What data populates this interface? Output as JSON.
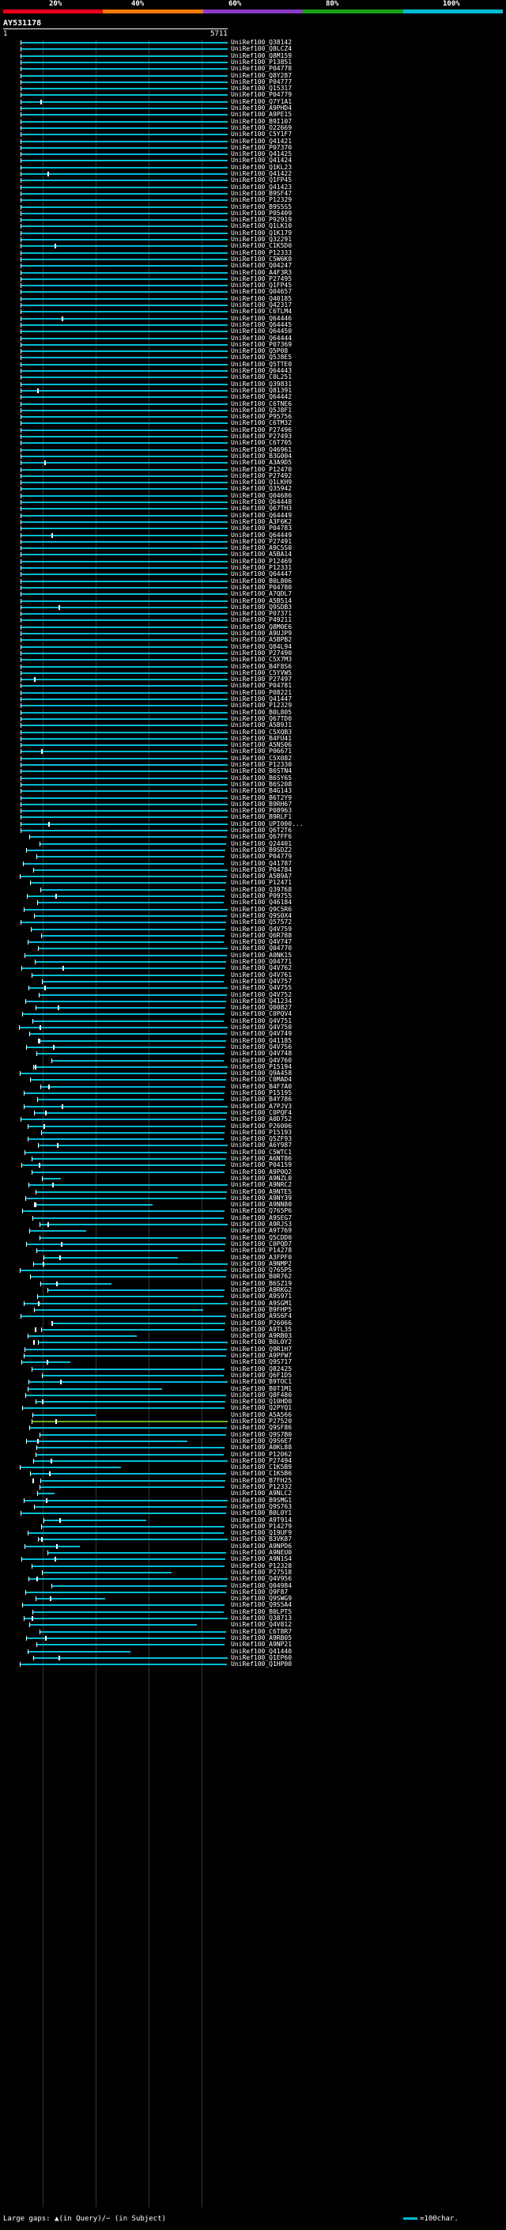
{
  "scale": {
    "labels": [
      "20%",
      "40%",
      "60%",
      "80%",
      "100%"
    ],
    "colors": [
      "#e8001c",
      "#f07800",
      "#8a3cc8",
      "#19a019",
      "#00bcd4"
    ]
  },
  "query": {
    "id": "AY531178",
    "start": "1",
    "end": "5711"
  },
  "hits": [
    "UniRef100_Q38142",
    "UniRef100_Q8LCZ4",
    "UniRef100_Q8M159",
    "UniRef100_P13851",
    "UniRef100_P04778",
    "UniRef100_Q8Y287",
    "UniRef100_P04777",
    "UniRef100_Q15317",
    "UniRef100_P04779",
    "UniRef100_Q7Y1A1",
    "UniRef100_A9PHD4",
    "UniRef100_A9PE15",
    "UniRef100_B9I107",
    "UniRef100_O22669",
    "UniRef100_C5Y1F7",
    "UniRef100_Q41421",
    "UniRef100_P07370",
    "UniRef100_Q41425",
    "UniRef100_Q41424",
    "UniRef100_Q1KL23",
    "UniRef100_Q41422",
    "UniRef100_Q1FP45",
    "UniRef100_Q41423",
    "UniRef100_B9SF47",
    "UniRef100_P12329",
    "UniRef100_B9S5S5",
    "UniRef100_P05409",
    "UniRef100_P92919",
    "UniRef100_Q1LK10",
    "UniRef100_Q1K179",
    "UniRef100_Q32291",
    "UniRef100_C1K5D0",
    "UniRef100_P12333",
    "UniRef100_C5W6K0",
    "UniRef100_Q04247",
    "UniRef100_A4F3R3",
    "UniRef100_P27495",
    "UniRef100_Q1FP45",
    "UniRef100_Q04657",
    "UniRef100_Q40185",
    "UniRef100_Q42317",
    "UniRef100_C6TLM4",
    "UniRef100_Q64446",
    "UniRef100_Q64445",
    "UniRef100_Q64450",
    "UniRef100_Q64444",
    "UniRef100_P07369",
    "UniRef100_Q5P08",
    "UniRef100_Q5J8E5",
    "UniRef100_Q5TTE0",
    "UniRef100_Q64443",
    "UniRef100_C0L251",
    "UniRef100_Q39831",
    "UniRef100_Q81391",
    "UniRef100_Q64442",
    "UniRef100_C6TNE6",
    "UniRef100_Q5J8F1",
    "UniRef100_P95756",
    "UniRef100_C6TM32",
    "UniRef100_P27496",
    "UniRef100_P27493",
    "UniRef100_C6T705",
    "UniRef100_Q46961",
    "UniRef100_B3G004",
    "UniRef100_A3A9D5",
    "UniRef100_P12470",
    "UniRef100_P27492",
    "UniRef100_Q1LKH9",
    "UniRef100_Q35942",
    "UniRef100_Q04686",
    "UniRef100_Q64448",
    "UniRef100_Q67TH3",
    "UniRef100_Q64449",
    "UniRef100_A3F6K2",
    "UniRef100_P04783",
    "UniRef100_Q64449",
    "UniRef100_P27491",
    "UniRef100_A9CSS0",
    "UniRef100_A5BA14",
    "UniRef100_P12469",
    "UniRef100_P12331",
    "UniRef100_Q64447",
    "UniRef100_B0L806",
    "UniRef100_P04780",
    "UniRef100_A7QDL7",
    "UniRef100_A5B514",
    "UniRef100_Q9SDB3",
    "UniRef100_P07371",
    "UniRef100_P49211",
    "UniRef100_Q8M0E6",
    "UniRef100_A9UJP9",
    "UniRef100_A5BPB2",
    "UniRef100_Q84L94",
    "UniRef100_P27490",
    "UniRef100_C5X7M3",
    "UniRef100_B4F8S6",
    "UniRef100_C5YVW5",
    "UniRef100_P27497",
    "UniRef100_P04781",
    "UniRef100_P08221",
    "UniRef100_Q41447",
    "UniRef100_P12329",
    "UniRef100_B0L805",
    "UniRef100_Q67TD0",
    "UniRef100_A5B9J1",
    "UniRef100_C5XQB3",
    "UniRef100_B4FU41",
    "UniRef100_A5NS06",
    "UniRef100_P06671",
    "UniRef100_C5X082",
    "UniRef100_P12330",
    "UniRef100_B6STN4",
    "UniRef100_B6SY65",
    "UniRef100_B6S208",
    "UniRef100_B4G143",
    "UniRef100_B6T2Y9",
    "UniRef100_B9RH67",
    "UniRef100_P08963",
    "UniRef100_B9RLF1",
    "UniRef100_UPI000...",
    "UniRef100_Q6T2T6",
    "UniRef100_Q67FF6",
    "UniRef100_Q24401",
    "UniRef100_B9SDZ2",
    "UniRef100_P04779",
    "UniRef100_Q41787",
    "UniRef100_P04784",
    "UniRef100_A5B9A7",
    "UniRef100_P12471",
    "UniRef100_Q39768",
    "UniRef100_P09755",
    "UniRef100_Q46184",
    "UniRef100_Q9C5R6",
    "UniRef100_Q9S0X4",
    "UniRef100_Q57572",
    "UniRef100_Q4V759",
    "UniRef100_Q6R788",
    "UniRef100_Q4V747",
    "UniRef100_Q04770",
    "UniRef100_A0NK15",
    "UniRef100_Q04771",
    "UniRef100_Q4V762",
    "UniRef100_Q4V761",
    "UniRef100_Q4V757",
    "UniRef100_Q4V755",
    "UniRef100_Q4V752",
    "UniRef100_Q41234",
    "UniRef100_Q00827",
    "UniRef100_C0PQV4",
    "UniRef100_Q4V751",
    "UniRef100_Q4V750",
    "UniRef100_Q4V749",
    "UniRef100_Q41185",
    "UniRef100_Q4V756",
    "UniRef100_Q4V748",
    "UniRef100_Q4V760",
    "UniRef100_P15194",
    "UniRef100_Q9A458",
    "UniRef100_C0MAD4",
    "UniRef100_B4F7A0",
    "UniRef100_P15195",
    "UniRef100_B4Y786",
    "UniRef100_A7PJV3",
    "UniRef100_C0PQF4",
    "UniRef100_A0D752",
    "UniRef100_P26006",
    "UniRef100_P15193",
    "UniRef100_Q5ZF93",
    "UniRef100_A6Y987",
    "UniRef100_C5WTC1",
    "UniRef100_A6NT86",
    "UniRef100_P04159",
    "UniRef100_A9P0Q2",
    "UniRef100_A9NZL0",
    "UniRef100_A9NRC2",
    "UniRef100_A9NTE5",
    "UniRef100_A9NY39",
    "UniRef100_A9NN80",
    "UniRef100_Q765P6",
    "UniRef100_A9SEG7",
    "UniRef100_A9RJS3",
    "UniRef100_A9T769",
    "UniRef100_Q5CDD0",
    "UniRef100_C0PQD7",
    "UniRef100_P14278",
    "UniRef100_A3FPF0",
    "UniRef100_A9NMP2",
    "UniRef100_Q765P5",
    "UniRef100_B0R762",
    "UniRef100_B6SZ19",
    "UniRef100_A9RKG2",
    "UniRef100_A9S971",
    "UniRef100_A9SGM1",
    "UniRef100_B9FHP5",
    "UniRef100_A9S6F4",
    "UniRef100_P26066",
    "UniRef100_A9TL35",
    "UniRef100_A9RB03",
    "UniRef100_B0L0Y2",
    "UniRef100_Q9R1H7",
    "UniRef100_A9PFW7",
    "UniRef100_Q9S717",
    "UniRef100_Q82425",
    "UniRef100_Q6F1D5",
    "UniRef100_B9TOC1",
    "UniRef100_B0T1M1",
    "UniRef100_Q8F480",
    "UniRef100_Q10HD0",
    "UniRef100_Q2PYQ1",
    "UniRef100_A5A566",
    "UniRef100_P27520",
    "UniRef100_Q9SF86",
    "UniRef100_Q9S7B0",
    "UniRef100_Q9S6E7",
    "UniRef100_A0KL88",
    "UniRef100_P12062",
    "UniRef100_P27494",
    "UniRef100_C1K5B9",
    "UniRef100_C1K5B6",
    "UniRef100_B7FH25",
    "UniRef100_P12332",
    "UniRef100_A9NLC2",
    "UniRef100_B9SMG1",
    "UniRef100_Q9S763",
    "UniRef100_B0L0Y1",
    "UniRef100_A9T914",
    "UniRef100_P14279",
    "UniRef100_Q19UF9",
    "UniRef100_B3VK87",
    "UniRef100_A9NPD6",
    "UniRef100_A9NEU0",
    "UniRef100_A9N1S4",
    "UniRef100_P12328",
    "UniRef100_P27518",
    "UniRef100_Q4V956",
    "UniRef100_Q04984",
    "UniRef100_Q9F87",
    "UniRef100_Q9SWG9",
    "UniRef100_Q9S5A4",
    "UniRef100_B0LPT5",
    "UniRef100_Q38713",
    "UniRef100_Q4V812",
    "UniRef100_C6T8R7",
    "UniRef100_A9RB05",
    "UniRef100_A9NP21",
    "UniRef100_Q41440",
    "UniRef100_Q1EP60",
    "UniRef100_Q1HP00"
  ],
  "legend": {
    "text": "Large gaps: ▲(in Query)/− (in Subject)",
    "scale_text": "=100char."
  }
}
